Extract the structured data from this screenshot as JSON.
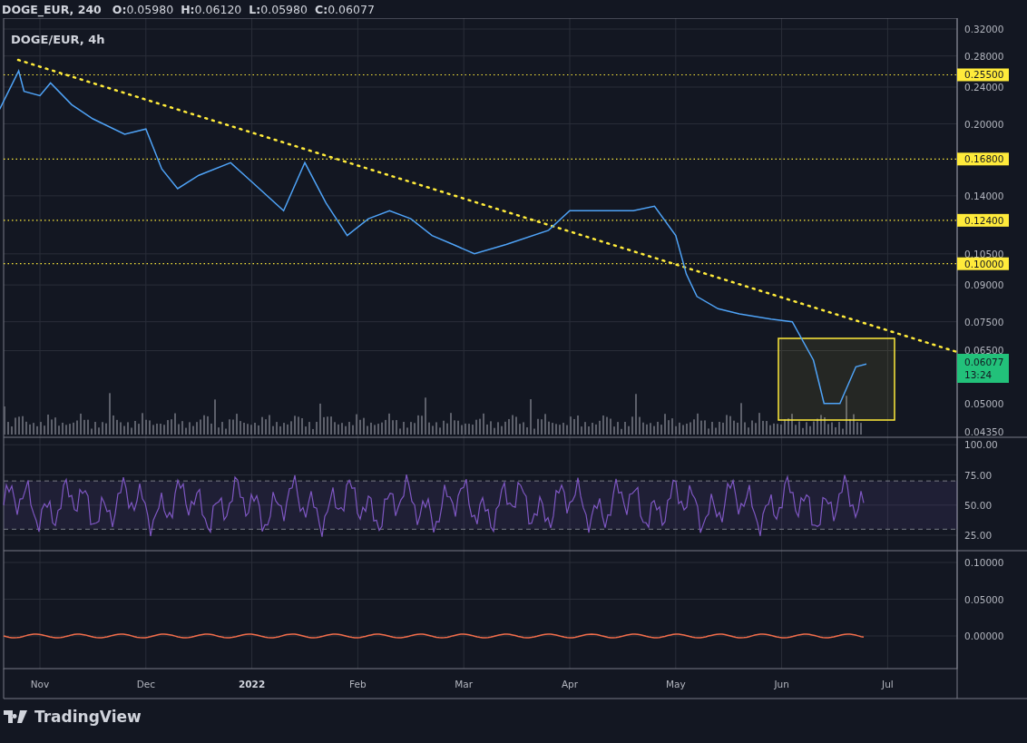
{
  "header": {
    "symbol": "DOGE_EUR, 240",
    "ohlc": [
      {
        "key": "O:",
        "value": "0.05980"
      },
      {
        "key": "H:",
        "value": "0.06120"
      },
      {
        "key": "L:",
        "value": "0.05980"
      },
      {
        "key": "C:",
        "value": "0.06077"
      }
    ]
  },
  "legend": "DOGE/EUR, 4h",
  "price_axis": [
    "0.32000",
    "0.28000",
    "0.24000",
    "0.20000",
    "0.14000",
    "0.10500",
    "0.09000",
    "0.07500",
    "0.06500",
    "0.05000",
    "0.04350"
  ],
  "levels": [
    {
      "label": "0.25500"
    },
    {
      "label": "0.16800"
    },
    {
      "label": "0.12400"
    },
    {
      "label": "0.10000"
    }
  ],
  "last_price": {
    "value": "0.06077",
    "countdown": "13:24"
  },
  "rsi_axis": [
    "100.00",
    "75.00",
    "50.00",
    "25.00"
  ],
  "macd_axis": [
    "0.10000",
    "0.05000",
    "0.00000"
  ],
  "time_axis": [
    {
      "label": "Nov",
      "kind": "month"
    },
    {
      "label": "Dec",
      "kind": "month"
    },
    {
      "label": "2022",
      "kind": "year"
    },
    {
      "label": "Feb",
      "kind": "month"
    },
    {
      "label": "Mar",
      "kind": "month"
    },
    {
      "label": "Apr",
      "kind": "month"
    },
    {
      "label": "May",
      "kind": "month"
    },
    {
      "label": "Jun",
      "kind": "month"
    },
    {
      "label": "Jul",
      "kind": "month"
    }
  ],
  "logo": "TradingView"
}
